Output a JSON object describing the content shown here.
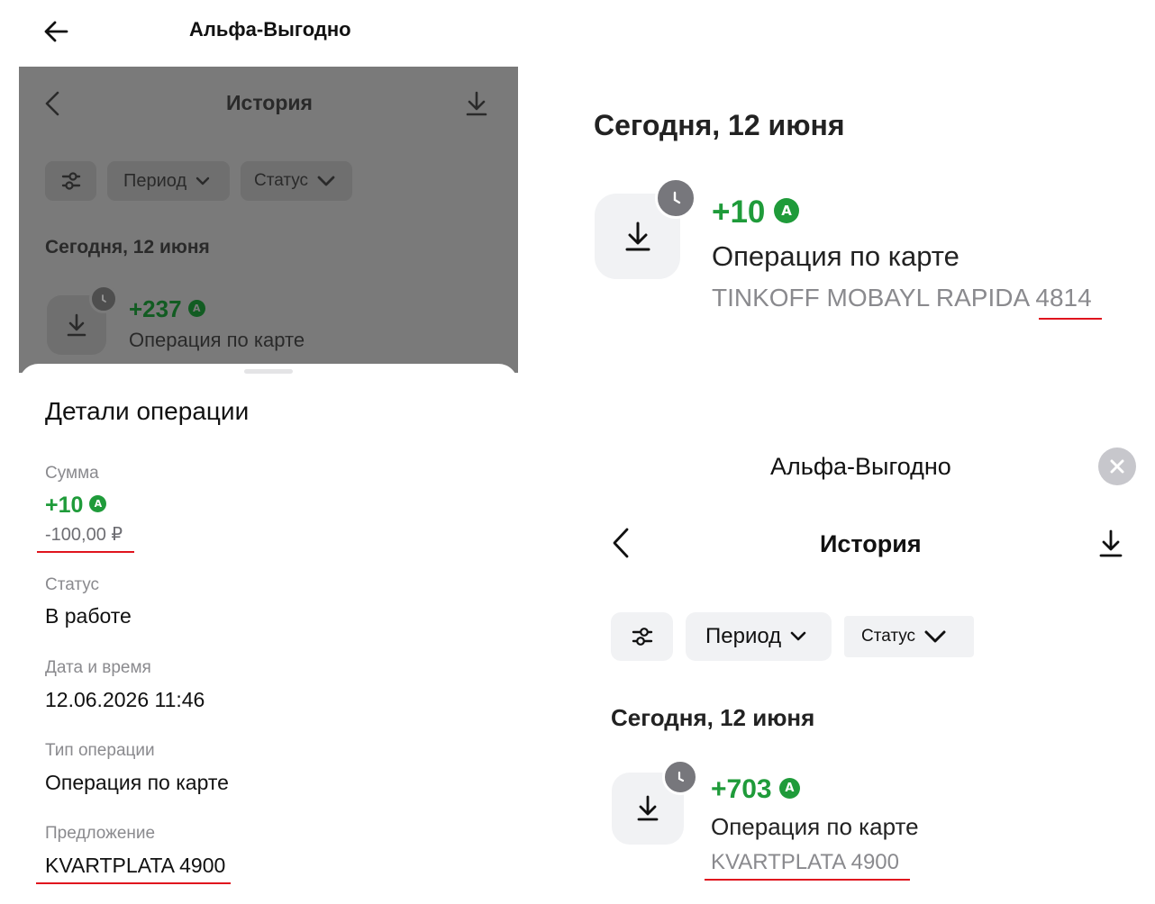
{
  "top_bar": {
    "title": "Альфа-Выгодно"
  },
  "left_history": {
    "title": "История",
    "filters": {
      "period": "Период",
      "status": "Статус"
    },
    "date_header": "Сегодня, 12 июня",
    "operation": {
      "amount": "+237",
      "badge": "A",
      "desc": "Операция по карте"
    }
  },
  "details": {
    "title": "Детали операции",
    "sum_label": "Сумма",
    "sum_points": "+10",
    "sum_badge": "A",
    "sum_rub": "-100,00 ₽",
    "status_label": "Статус",
    "status_value": "В работе",
    "datetime_label": "Дата и время",
    "datetime_value": "12.06.2026 11:46",
    "type_label": "Тип операции",
    "type_value": "Операция по карте",
    "offer_label": "Предложение",
    "offer_value": "KVARTPLATA 4900"
  },
  "right_top": {
    "date_header": "Сегодня, 12 июня",
    "operation": {
      "amount": "+10",
      "badge": "A",
      "desc": "Операция по карте",
      "merchant": "TINKOFF MOBAYL RAPIDA 4814"
    }
  },
  "right_bottom": {
    "app_title": "Альфа-Выгодно",
    "title": "История",
    "filters": {
      "period": "Период",
      "status": "Статус"
    },
    "date_header": "Сегодня, 12 июня",
    "operation": {
      "amount": "+703",
      "badge": "A",
      "desc": "Операция по карте",
      "merchant": "KVARTPLATA 4900"
    }
  },
  "colors": {
    "green": "#1f9b3a",
    "red_underline": "#e0141e",
    "chip_bg": "#f1f2f4",
    "overlay": "#7a7a7a"
  }
}
